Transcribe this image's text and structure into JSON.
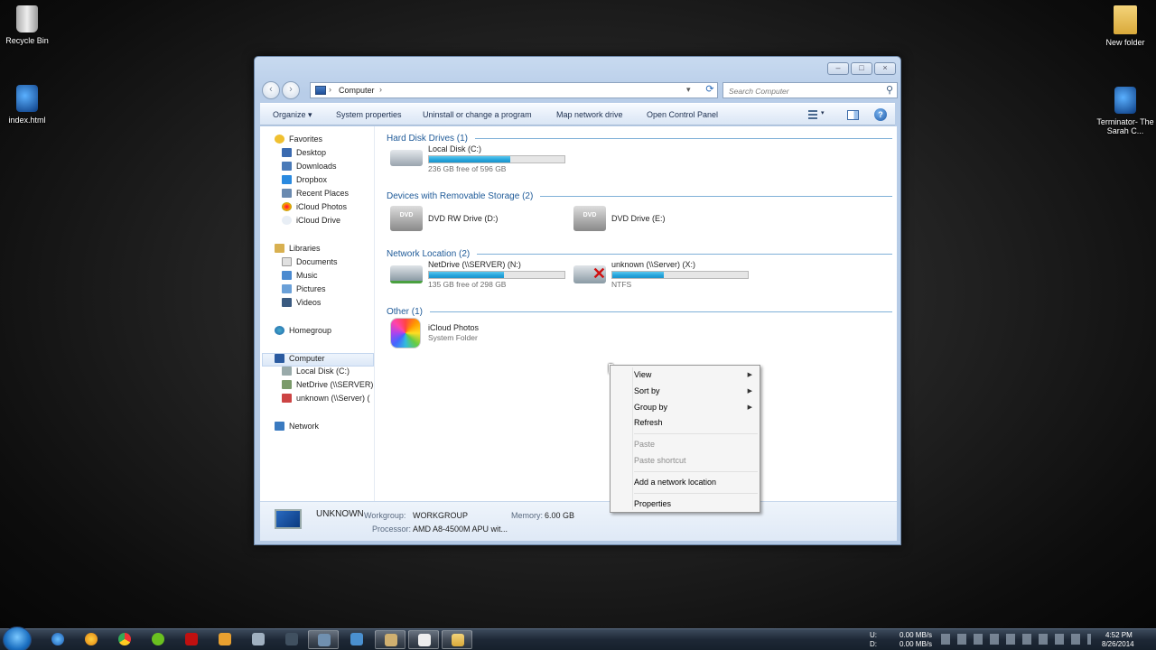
{
  "desktop": {
    "icons": [
      {
        "label": "Recycle Bin"
      },
      {
        "label": "index.html"
      },
      {
        "label": "New folder"
      },
      {
        "label": "Terminator- The Sarah C..."
      }
    ]
  },
  "window": {
    "address": {
      "location": "Computer"
    },
    "search": {
      "placeholder": "Search Computer"
    },
    "toolbar": {
      "organize": "Organize",
      "system_properties": "System properties",
      "uninstall": "Uninstall or change a program",
      "map_drive": "Map network drive",
      "control_panel": "Open Control Panel"
    },
    "nav": {
      "favorites": "Favorites",
      "desktop": "Desktop",
      "downloads": "Downloads",
      "dropbox": "Dropbox",
      "recent": "Recent Places",
      "icloud_photos": "iCloud Photos",
      "icloud_drive": "iCloud Drive",
      "libraries": "Libraries",
      "documents": "Documents",
      "music": "Music",
      "pictures": "Pictures",
      "videos": "Videos",
      "homegroup": "Homegroup",
      "computer": "Computer",
      "local_disk": "Local Disk (C:)",
      "netdrive": "NetDrive (\\\\SERVER) (",
      "unknown": "unknown (\\\\Server) (",
      "network": "Network"
    },
    "groups": {
      "hdd": "Hard Disk Drives (1)",
      "removable": "Devices with Removable Storage (2)",
      "network": "Network Location (2)",
      "other": "Other (1)"
    },
    "drives": {
      "c": {
        "name": "Local Disk (C:)",
        "sub": "236 GB free of 596 GB",
        "used_fraction": 0.6
      },
      "d": {
        "name": "DVD RW Drive (D:)"
      },
      "e": {
        "name": "DVD Drive (E:)"
      },
      "n": {
        "name": "NetDrive (\\\\SERVER) (N:)",
        "sub": "135 GB free of 298 GB",
        "used_fraction": 0.55
      },
      "x": {
        "name": "unknown (\\\\Server) (X:)",
        "sub": "NTFS",
        "used_fraction": 0.38
      },
      "icloud": {
        "name": "iCloud Photos",
        "sub": "System Folder"
      }
    },
    "details": {
      "computer_name": "UNKNOWN",
      "workgroup_label": "Workgroup:",
      "workgroup": "WORKGROUP",
      "memory_label": "Memory:",
      "memory": "6.00 GB",
      "processor_label": "Processor:",
      "processor": "AMD A8-4500M APU wit..."
    }
  },
  "context_menu": {
    "view": "View",
    "sort_by": "Sort by",
    "group_by": "Group by",
    "refresh": "Refresh",
    "paste": "Paste",
    "paste_shortcut": "Paste shortcut",
    "add_network": "Add a network location",
    "properties": "Properties"
  },
  "taskbar": {
    "net_u_label": "U:",
    "net_d_label": "D:",
    "net_u": "0.00 MB/s",
    "net_d": "0.00 MB/s",
    "time": "4:52 PM",
    "date": "8/26/2014"
  }
}
